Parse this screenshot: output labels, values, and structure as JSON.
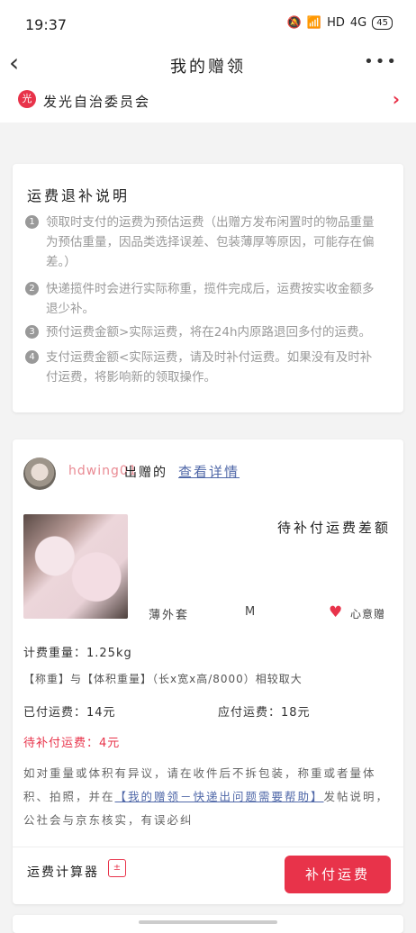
{
  "status_bar": {
    "time": "19:37",
    "icons": [
      "mute-bell-icon",
      "wifi-icon",
      "HD",
      "signal-icon"
    ],
    "hd": "HD",
    "signal": "4G",
    "battery": "45"
  },
  "nav": {
    "title": "我的赠领",
    "more": "•••"
  },
  "org": {
    "icon_text": "光",
    "name": "发光自治委员会"
  },
  "notice": {
    "title": "运费退补说明",
    "items": [
      {
        "num": "1",
        "text": "领取时支付的运费为预估运费（出赠方发布闲置时的物品重量\n为预估重量，因品类选择误差、包装薄厚等原因，可能存在偏\n差。）"
      },
      {
        "num": "2",
        "text": "快递揽件时会进行实际称重，揽件完成后，运费按实收金额多\n退少补。"
      },
      {
        "num": "3",
        "text": "预付运费金额>实际运费，将在24h内原路退回多付的运费。"
      },
      {
        "num": "4",
        "text": "支付运费金额<实际运费，请及时补付运费。如果没有及时补\n付运费，将影响新的领取操作。"
      }
    ]
  },
  "order": {
    "giver": "hdwing01",
    "giver_suffix": "出赠的",
    "detail_link": "查看详情",
    "product": {
      "status": "待补付运费差额",
      "name": "薄外套",
      "size": "M",
      "tag": "心意赠"
    },
    "weight_label": "计费重量：1.25kg",
    "weight_rule": "【称重】与【体积重量】（长x宽x高/8000）相较取大",
    "paid": "已付运费：14元",
    "due": "应付运费：18元",
    "pending": "待补付运费：4元",
    "note_before": "如对重量或体积有异议，请在收件后不拆包装，称重或者量体积、拍照，并在",
    "note_link": "【我的赠领－快递出问题需要帮助】",
    "note_after": "发帖说明，公社会与京东核实，有误必纠",
    "calc_label": "运费计算器",
    "pay_button": "补付运费"
  },
  "colors": {
    "accent": "#e8334a",
    "link": "#5068a8",
    "giver": "#e98a93"
  }
}
